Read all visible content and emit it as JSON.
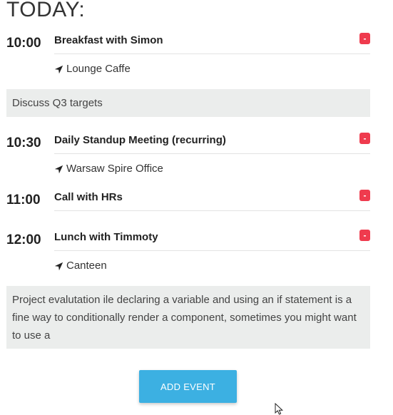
{
  "header": {
    "title": "TODAY:"
  },
  "events": [
    {
      "time": "10:00",
      "title": "Breakfast with Simon",
      "location": "Lounge Caffe",
      "remove_label": "-"
    },
    {
      "time": "10:30",
      "title": "Daily Standup Meeting (recurring)",
      "location": "Warsaw Spire Office",
      "remove_label": "-"
    },
    {
      "time": "11:00",
      "title": "Call with HRs",
      "location": "",
      "remove_label": "-"
    },
    {
      "time": "12:00",
      "title": "Lunch with Timmoty",
      "location": "Canteen",
      "remove_label": "-"
    }
  ],
  "notes": [
    "Discuss Q3 targets",
    "Project evalutation ile declaring a variable and using an if statement is a fine way to conditionally render a component, sometimes you might want to use a"
  ],
  "actions": {
    "add_event_label": "ADD EVENT"
  },
  "icons": {
    "location": "location-arrow-icon",
    "remove": "minus-icon",
    "cursor": "mouse-pointer-icon"
  },
  "colors": {
    "remove_button": "#ef3b4e",
    "add_button": "#3cb0e2",
    "note_background": "#ebedec"
  }
}
